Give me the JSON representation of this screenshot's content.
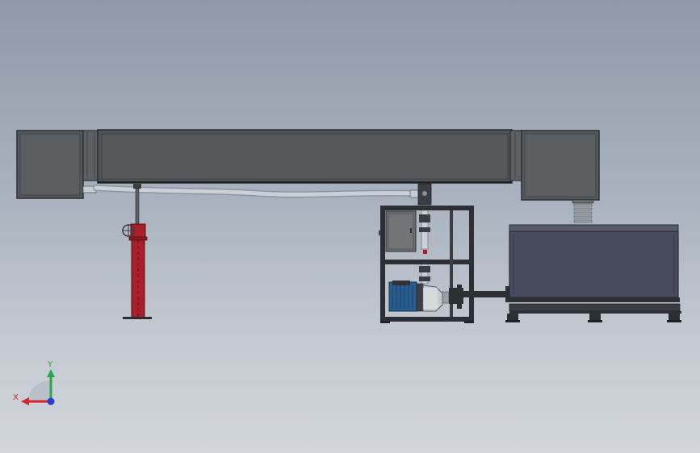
{
  "view": {
    "kind": "cad-front-view",
    "background_top": "#8e9aa9",
    "background_bottom": "#d2d6db"
  },
  "triad": {
    "x_label": "X",
    "y_label": "Y",
    "x_color": "#d6262b",
    "y_color": "#2aa54a",
    "z_color": "#2a3bd6"
  },
  "colors": {
    "tank_dark": "#525659",
    "tank_edge": "#2b2e31",
    "frame": "#2c2f33",
    "red_column": "#a8202a",
    "reservoir": "#484a5e",
    "pipe": "#b9c2cb",
    "motor": "#2a5d8f",
    "cabinet": "#6b6d6f"
  },
  "icons": {
    "valve": "valve-wheel-icon",
    "pump": "pump-motor-icon",
    "spring": "spring-icon"
  }
}
